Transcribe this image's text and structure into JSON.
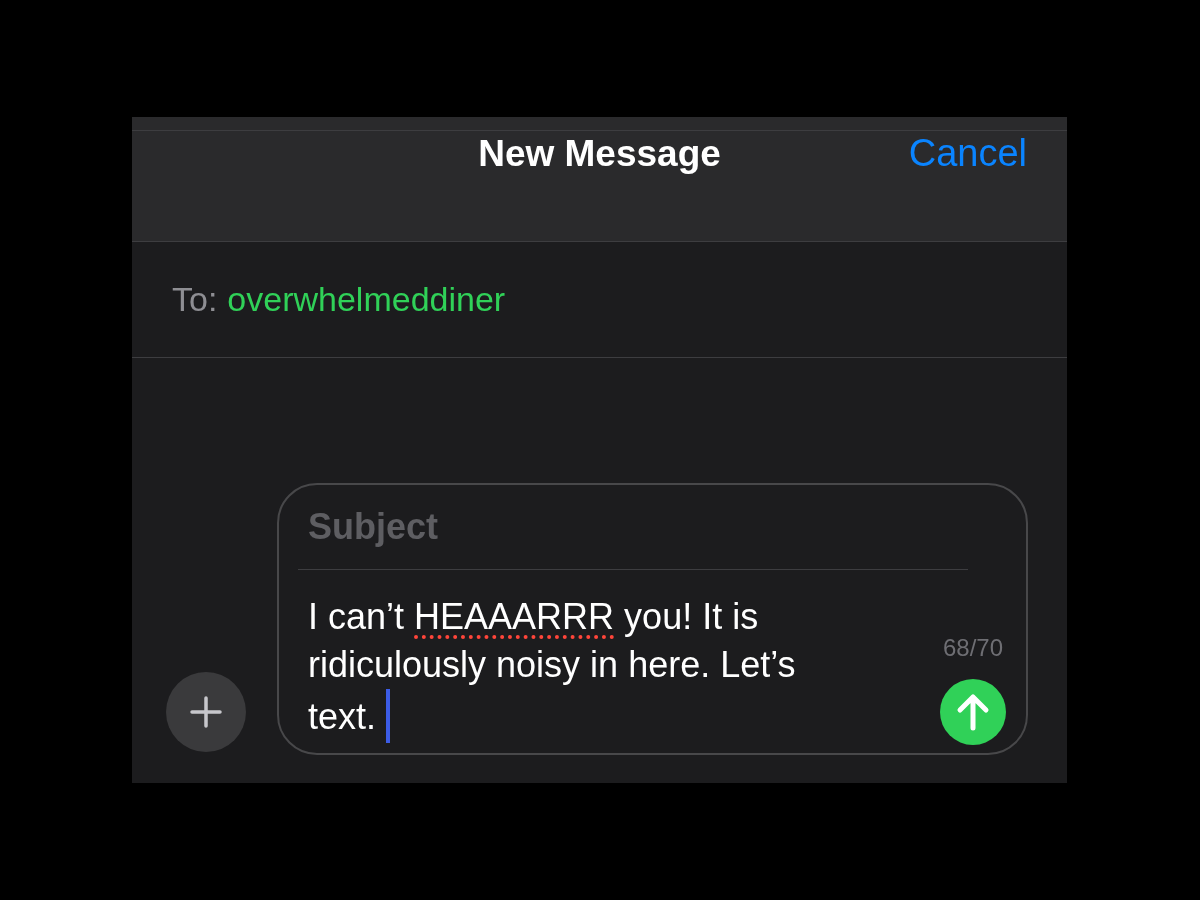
{
  "header": {
    "title": "New Message",
    "cancel": "Cancel"
  },
  "to": {
    "label": "To:",
    "recipient": "overwhelmeddiner"
  },
  "compose": {
    "subject_placeholder": "Subject",
    "body": [
      {
        "text": "I can’t ",
        "misspelled": false
      },
      {
        "text": "HEAAARRR",
        "misspelled": true
      },
      {
        "text": " you! It is ridiculously noisy in here. Let’s text.",
        "misspelled": false
      }
    ],
    "focused": true,
    "counter": "68/70"
  }
}
